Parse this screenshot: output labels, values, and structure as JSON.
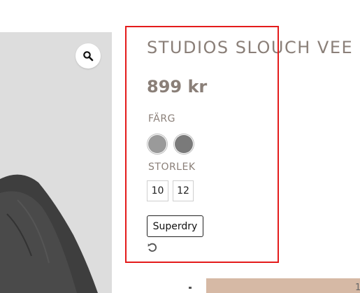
{
  "product": {
    "title": "STUDIOS SLOUCH VEE",
    "price": "899 kr"
  },
  "options": {
    "color_label": "FÄRG",
    "colors": [
      {
        "name": "light-grey",
        "hex": "#9a9a9a"
      },
      {
        "name": "dark-grey",
        "hex": "#7a7a7a"
      }
    ],
    "size_label": "STORLEK",
    "sizes": [
      "10",
      "12"
    ]
  },
  "brand": {
    "label": "Superdry"
  },
  "icons": {
    "zoom": "magnifier-icon",
    "reset": "reset-icon"
  },
  "bottom": {
    "partial_text": "1"
  },
  "colors": {
    "accent_text": "#8a7f78",
    "highlight": "#e41b1b",
    "image_bg": "#dcdcdc",
    "bottom_block": "#d6b9a5"
  }
}
